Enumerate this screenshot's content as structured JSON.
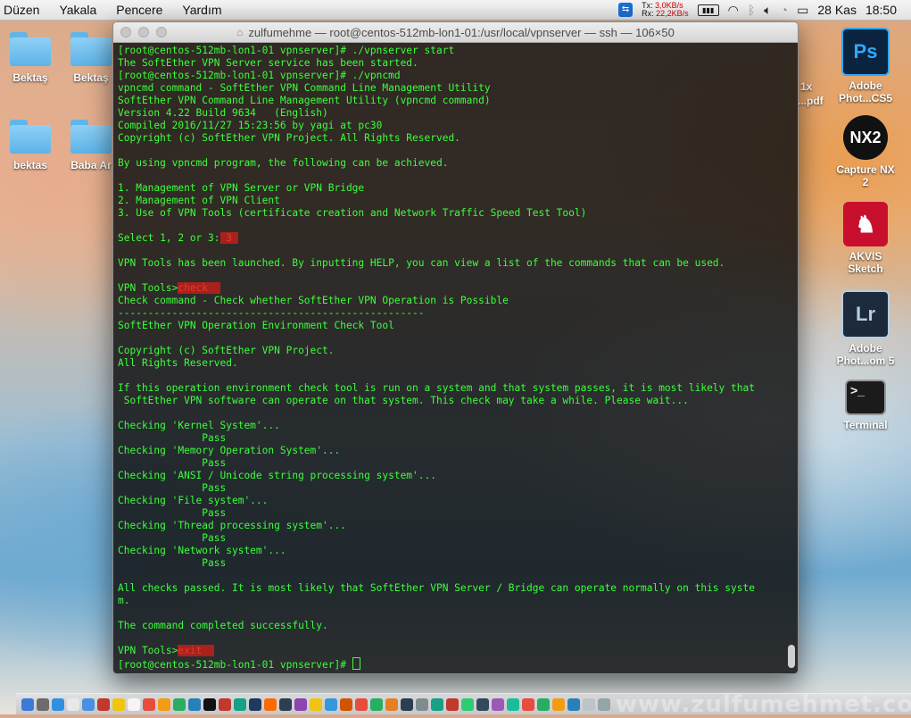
{
  "menubar": {
    "items": [
      "Düzen",
      "Yakala",
      "Pencere",
      "Yardım"
    ],
    "network": {
      "tx_label": "Tx:",
      "tx": "3,0KB/s",
      "rx_label": "Rx:",
      "rx": "22,2KB/s"
    },
    "date": "28 Kas",
    "time": "18:50"
  },
  "desktop": {
    "left_icons": [
      {
        "label": "Bektaş"
      },
      {
        "label": "Bektaş"
      },
      {
        "label": "bektas"
      },
      {
        "label": "Baba Ar"
      }
    ],
    "right_icons": [
      {
        "label": "Adobe Phot...CS5",
        "icon_text": "Ps",
        "icon": "photoshop-icon"
      },
      {
        "label": "Capture NX 2",
        "icon_text": "NX2",
        "icon": "capture-nx-icon"
      },
      {
        "label": "AKVIS Sketch",
        "icon_text": "",
        "icon": "akvis-horse-icon"
      },
      {
        "label": "Adobe Phot...om 5",
        "icon_text": "Lr",
        "icon": "lightroom-icon"
      },
      {
        "label": "Terminal",
        "icon_text": ">_",
        "icon": "terminal-icon"
      }
    ],
    "clipped_texts": [
      "1x",
      "...pdf"
    ]
  },
  "window": {
    "title": "zulfumehme — root@centos-512mb-lon1-01:/usr/local/vpnserver — ssh — 106×50",
    "colors": {
      "text": "#3cff3c",
      "highlight": "#a8211d"
    }
  },
  "terminal": {
    "lines": [
      "[root@centos-512mb-lon1-01 vpnserver]# ./vpnserver start",
      "The SoftEther VPN Server service has been started.",
      "[root@centos-512mb-lon1-01 vpnserver]# ./vpncmd",
      "vpncmd command - SoftEther VPN Command Line Management Utility",
      "SoftEther VPN Command Line Management Utility (vpncmd command)",
      "Version 4.22 Build 9634   (English)",
      "Compiled 2016/11/27 15:23:56 by yagi at pc30",
      "Copyright (c) SoftEther VPN Project. All Rights Reserved.",
      "",
      "By using vpncmd program, the following can be achieved.",
      "",
      "1. Management of VPN Server or VPN Bridge",
      "2. Management of VPN Client",
      "3. Use of VPN Tools (certificate creation and Network Traffic Speed Test Tool)",
      "",
      "",
      "",
      "VPN Tools has been launched. By inputting HELP, you can view a list of the commands that can be used.",
      "",
      "",
      "Check command - Check whether SoftEther VPN Operation is Possible",
      "---------------------------------------------------",
      "SoftEther VPN Operation Environment Check Tool",
      "",
      "Copyright (c) SoftEther VPN Project.",
      "All Rights Reserved.",
      "",
      "If this operation environment check tool is run on a system and that system passes, it is most likely that",
      " SoftEther VPN software can operate on that system. This check may take a while. Please wait...",
      "",
      "Checking 'Kernel System'...",
      "              Pass",
      "Checking 'Memory Operation System'...",
      "              Pass",
      "Checking 'ANSI / Unicode string processing system'...",
      "              Pass",
      "Checking 'File system'...",
      "              Pass",
      "Checking 'Thread processing system'...",
      "              Pass",
      "Checking 'Network system'...",
      "              Pass",
      "",
      "All checks passed. It is most likely that SoftEther VPN Server / Bridge can operate normally on this syste",
      "m.",
      "",
      "The command completed successfully.",
      "",
      "",
      ""
    ],
    "select_prompt": "Select 1, 2 or 3:",
    "select_input": " 3 ",
    "tools_prompt": "VPN Tools>",
    "check_input": "check  ",
    "exit_input": "exit  ",
    "final_prompt": "[root@centos-512mb-lon1-01 vpnserver]# "
  },
  "watermark": "www.zulfumehmet.com"
}
